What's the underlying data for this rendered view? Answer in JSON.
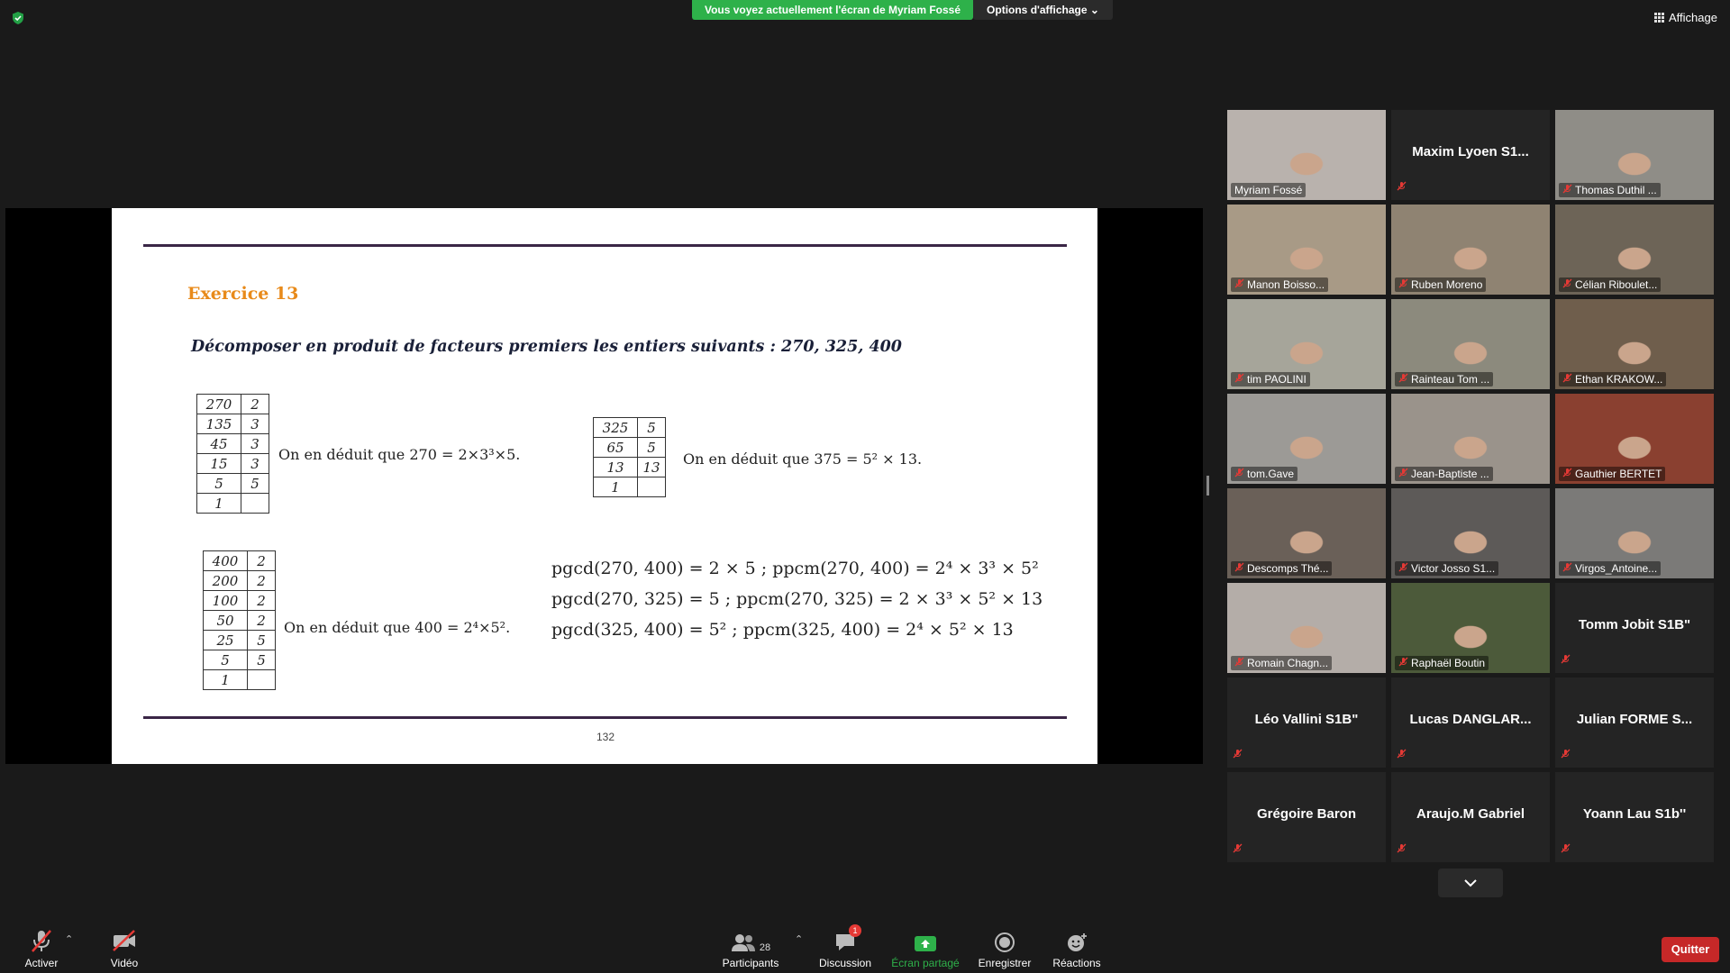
{
  "top": {
    "share_banner": "Vous voyez actuellement l'écran de Myriam Fossé",
    "view_options": "Options d'affichage",
    "view_layout": "Affichage"
  },
  "slide": {
    "exercise_title": "Exercice 13",
    "instruction": "Décomposer en produit de facteurs premiers les entiers suivants : 270, 325, 400",
    "table_270": [
      [
        "270",
        "2"
      ],
      [
        "135",
        "3"
      ],
      [
        "45",
        "3"
      ],
      [
        "15",
        "3"
      ],
      [
        "5",
        "5"
      ],
      [
        "1",
        ""
      ]
    ],
    "table_325": [
      [
        "325",
        "5"
      ],
      [
        "65",
        "5"
      ],
      [
        "13",
        "13"
      ],
      [
        "1",
        ""
      ]
    ],
    "table_400": [
      [
        "400",
        "2"
      ],
      [
        "200",
        "2"
      ],
      [
        "100",
        "2"
      ],
      [
        "50",
        "2"
      ],
      [
        "25",
        "5"
      ],
      [
        "5",
        "5"
      ],
      [
        "1",
        ""
      ]
    ],
    "deduce_270": "On en déduit que 270 = 2×3³×5.",
    "deduce_325": "On en déduit que 375 = 5² × 13.",
    "deduce_400": "On en déduit que 400 = 2⁴×5².",
    "pgcd_lines": [
      "pgcd(270, 400) = 2 × 5 ; ppcm(270, 400) = 2⁴ × 3³ × 5²",
      "pgcd(270, 325) = 5 ; ppcm(270, 325) = 2 × 3³ × 5² × 13",
      "pgcd(325, 400) = 5² ; ppcm(325, 400) = 2⁴ × 5² × 13"
    ],
    "page_number": "132"
  },
  "participants": [
    {
      "name": "Myriam Fossé",
      "video": true,
      "muted": false,
      "active": true,
      "bg": "#b9b2ad"
    },
    {
      "name": "Maxim  Lyoen  S1...",
      "video": false,
      "muted": true
    },
    {
      "name": "Thomas Duthil ...",
      "video": true,
      "muted": true,
      "bg": "#8f8d87"
    },
    {
      "name": "Manon Boisso...",
      "video": true,
      "muted": true,
      "bg": "#a89a86"
    },
    {
      "name": "Ruben Moreno",
      "video": true,
      "muted": true,
      "bg": "#8f8372"
    },
    {
      "name": "Célian Riboulet...",
      "video": true,
      "muted": true,
      "bg": "#6d6457"
    },
    {
      "name": "tim PAOLINI",
      "video": true,
      "muted": true,
      "bg": "#a6a59a"
    },
    {
      "name": "Rainteau Tom ...",
      "video": true,
      "muted": true,
      "bg": "#8c8a7d"
    },
    {
      "name": "Ethan KRAKOW...",
      "video": true,
      "muted": true,
      "bg": "#6f5e4c"
    },
    {
      "name": "tom.Gave",
      "video": true,
      "muted": true,
      "bg": "#9c9a96"
    },
    {
      "name": "Jean-Baptiste ...",
      "video": true,
      "muted": true,
      "bg": "#9a938b"
    },
    {
      "name": "Gauthier BERTET",
      "video": true,
      "muted": true,
      "bg": "#8a4030"
    },
    {
      "name": "Descomps Thé...",
      "video": true,
      "muted": true,
      "bg": "#6a6058"
    },
    {
      "name": "Victor Josso S1...",
      "video": true,
      "muted": true,
      "bg": "#5d5a58"
    },
    {
      "name": "Virgos_Antoine...",
      "video": true,
      "muted": true,
      "bg": "#7b7a78"
    },
    {
      "name": "Romain Chagn...",
      "video": true,
      "muted": true,
      "bg": "#b4ada8"
    },
    {
      "name": "Raphaël Boutin",
      "video": true,
      "muted": true,
      "bg": "#4c5a3a"
    },
    {
      "name": "Tomm Jobit S1B\"",
      "video": false,
      "muted": true
    },
    {
      "name": "Léo Vallini S1B\"",
      "video": false,
      "muted": true
    },
    {
      "name": "Lucas  DANGLAR...",
      "video": false,
      "muted": true
    },
    {
      "name": "Julian  FORME  S...",
      "video": false,
      "muted": true
    },
    {
      "name": "Grégoire Baron",
      "video": false,
      "muted": true
    },
    {
      "name": "Araujo.M Gabriel",
      "video": false,
      "muted": true
    },
    {
      "name": "Yoann Lau S1b''",
      "video": false,
      "muted": true
    }
  ],
  "toolbar": {
    "mic_label": "Activer",
    "video_label": "Vidéo",
    "participants_label": "Participants",
    "participants_count": "28",
    "chat_label": "Discussion",
    "chat_badge": "1",
    "share_label": "Écran partagé",
    "record_label": "Enregistrer",
    "reactions_label": "Réactions",
    "quit_label": "Quitter"
  },
  "colors": {
    "share_green": "#2eb14a",
    "active_speaker": "#c4e538",
    "quit_red": "#c62828",
    "exercise_orange": "#e88a1a"
  }
}
